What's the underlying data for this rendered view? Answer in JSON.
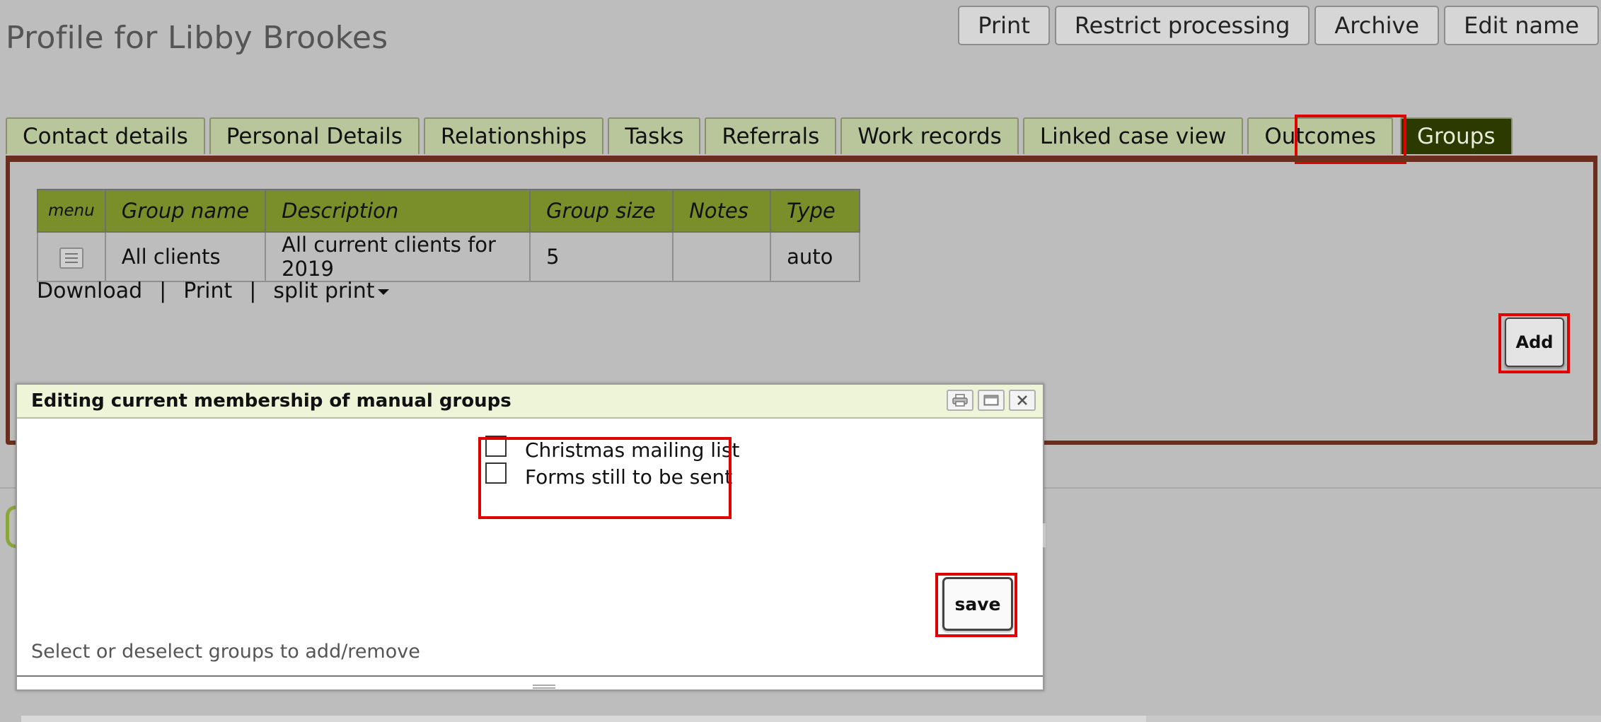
{
  "page": {
    "title": "Profile for Libby Brookes"
  },
  "actions": {
    "print": "Print",
    "restrict": "Restrict processing",
    "archive": "Archive",
    "edit_name": "Edit name"
  },
  "tabs": [
    "Contact details",
    "Personal Details",
    "Relationships",
    "Tasks",
    "Referrals",
    "Work records",
    "Linked case view",
    "Outcomes",
    "Groups"
  ],
  "active_tab": "Groups",
  "groups_table": {
    "headers": {
      "menu": "menu",
      "name": "Group name",
      "description": "Description",
      "size": "Group size",
      "notes": "Notes",
      "type": "Type"
    },
    "rows": [
      {
        "name": "All clients",
        "description": "All current clients for 2019",
        "size": "5",
        "notes": "",
        "type": "auto"
      }
    ]
  },
  "table_links": {
    "download": "Download",
    "separator": "|",
    "print": "Print",
    "split_print": "split print"
  },
  "add_button": "Add",
  "dialog": {
    "title": "Editing current membership of manual groups",
    "icons": [
      "printer-icon",
      "maximize-icon",
      "close-icon"
    ],
    "options": [
      {
        "label": "Christmas mailing list",
        "checked": false
      },
      {
        "label": "Forms still to be sent",
        "checked": false
      }
    ],
    "save": "save",
    "hint": "Select or deselect groups to add/remove"
  },
  "colors": {
    "tab_bg": "#b9c59a",
    "tab_active_bg": "#2c3a00",
    "table_header_bg": "#7a8f2a",
    "panel_border": "#6a2e1c",
    "highlight": "#e00000",
    "dialog_header_bg": "#eef4d8"
  }
}
